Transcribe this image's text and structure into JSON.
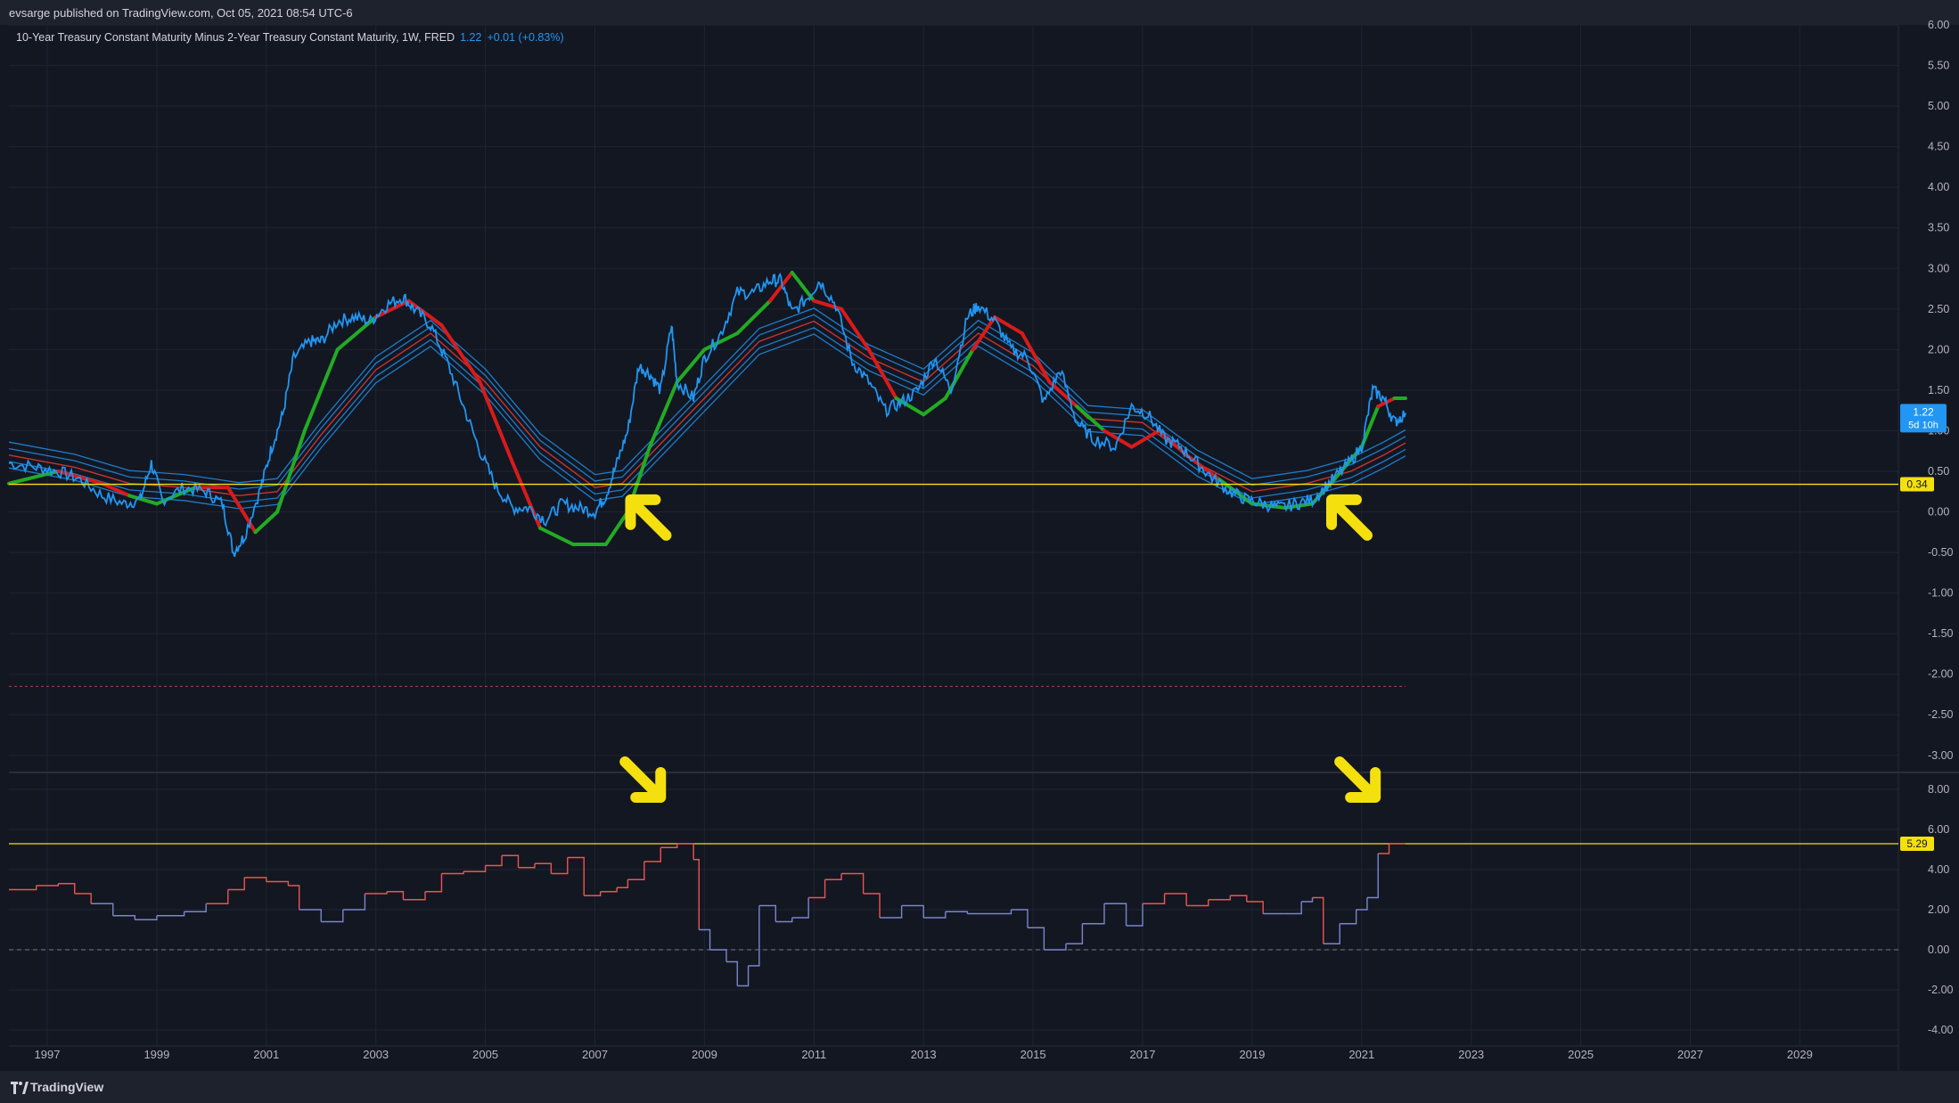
{
  "header": {
    "publisher": "evsarge published on TradingView.com, Oct 05, 2021 08:54 UTC-6"
  },
  "legend": {
    "symbol": "10-Year Treasury Constant Maturity Minus 2-Year Treasury Constant Maturity, 1W, FRED",
    "price": "1.22",
    "change": "+0.01 (+0.83%)"
  },
  "footer": {
    "brand": "TradingView",
    "logo_icon": "tradingview-logo-icon"
  },
  "colors": {
    "background": "#131722",
    "grid": "#1f2433",
    "price_line": "#2196f3",
    "ma_up": "#22ab23",
    "ma_down": "#d81b1b",
    "band": "#2196f3",
    "band_mid": "#e53935",
    "highlight_line": "#f5e00f",
    "oscillator_up": "#ef5350",
    "oscillator_down": "#7986cb"
  },
  "chart_data": [
    {
      "type": "line",
      "x_ticks": [
        "1997",
        "1999",
        "2001",
        "2003",
        "2005",
        "2007",
        "2009",
        "2011",
        "2013",
        "2015",
        "2017",
        "2019",
        "2021",
        "2023",
        "2025",
        "2027",
        "2029"
      ],
      "y_ticks": [
        "6.00",
        "5.50",
        "5.00",
        "4.50",
        "4.00",
        "3.50",
        "3.00",
        "2.50",
        "2.00",
        "1.50",
        "1.00",
        "0.50",
        "0.00",
        "-0.50",
        "-1.00",
        "-1.50",
        "-2.00",
        "-2.50",
        "-3.00"
      ],
      "ylim": [
        -3.2,
        6.0
      ],
      "xlim": [
        1996.3,
        2030.8
      ],
      "last_price_label": "1.22",
      "countdown_label": "5d 10h",
      "level_line_label": "0.34",
      "level_line_value": 0.34,
      "dashed_level": -2.15,
      "series": [
        {
          "key": "spread",
          "x": [
            1996.3,
            1996.8,
            1997.2,
            1997.6,
            1998.0,
            1998.4,
            1998.7,
            1998.9,
            1999.1,
            1999.5,
            1999.9,
            2000.2,
            2000.4,
            2000.6,
            2000.9,
            2001.1,
            2001.3,
            2001.5,
            2001.8,
            2002.0,
            2002.3,
            2002.6,
            2002.9,
            2003.2,
            2003.5,
            2003.7,
            2004.0,
            2004.3,
            2004.6,
            2004.9,
            2005.2,
            2005.5,
            2005.8,
            2006.1,
            2006.4,
            2006.7,
            2007.0,
            2007.2,
            2007.4,
            2007.6,
            2007.8,
            2008.0,
            2008.2,
            2008.4,
            2008.5,
            2008.8,
            2009.0,
            2009.3,
            2009.6,
            2009.9,
            2010.2,
            2010.4,
            2010.6,
            2010.9,
            2011.1,
            2011.4,
            2011.7,
            2012.0,
            2012.3,
            2012.6,
            2012.9,
            2013.2,
            2013.5,
            2013.8,
            2014.0,
            2014.3,
            2014.6,
            2014.9,
            2015.2,
            2015.5,
            2015.8,
            2016.1,
            2016.5,
            2016.8,
            2017.1,
            2017.4,
            2017.7,
            2018.0,
            2018.3,
            2018.6,
            2018.9,
            2019.2,
            2019.5,
            2019.8,
            2020.1,
            2020.4,
            2020.7,
            2021.0,
            2021.2,
            2021.4,
            2021.6,
            2021.8
          ],
          "y": [
            0.6,
            0.55,
            0.5,
            0.4,
            0.2,
            0.1,
            0.15,
            0.6,
            0.15,
            0.3,
            0.25,
            0.1,
            -0.5,
            -0.3,
            0.3,
            0.8,
            1.2,
            1.9,
            2.1,
            2.1,
            2.35,
            2.4,
            2.35,
            2.55,
            2.65,
            2.5,
            2.3,
            1.85,
            1.3,
            0.75,
            0.3,
            0.05,
            0.05,
            -0.1,
            0.1,
            0.05,
            0.0,
            0.2,
            0.6,
            1.0,
            1.8,
            1.7,
            1.5,
            2.3,
            1.6,
            1.4,
            1.9,
            2.2,
            2.7,
            2.7,
            2.85,
            2.85,
            2.45,
            2.65,
            2.85,
            2.55,
            1.85,
            1.6,
            1.25,
            1.35,
            1.5,
            1.9,
            1.5,
            2.4,
            2.55,
            2.35,
            2.0,
            1.9,
            1.35,
            1.75,
            1.1,
            0.9,
            0.8,
            1.3,
            1.2,
            0.9,
            0.8,
            0.6,
            0.4,
            0.25,
            0.15,
            0.1,
            0.05,
            0.1,
            0.15,
            0.35,
            0.55,
            0.8,
            1.5,
            1.4,
            1.1,
            1.22
          ]
        },
        {
          "key": "moving-average",
          "x": [
            1996.3,
            1997.2,
            1998.0,
            1998.5,
            1999.0,
            1999.7,
            2000.3,
            2000.8,
            2001.2,
            2001.7,
            2002.3,
            2003.0,
            2003.6,
            2004.2,
            2004.9,
            2005.5,
            2006.0,
            2006.6,
            2007.2,
            2007.6,
            2008.0,
            2008.5,
            2009.0,
            2009.6,
            2010.2,
            2010.6,
            2011.0,
            2011.5,
            2012.0,
            2012.5,
            2013.0,
            2013.4,
            2013.9,
            2014.3,
            2014.8,
            2015.3,
            2015.8,
            2016.3,
            2016.8,
            2017.3,
            2017.8,
            2018.4,
            2019.0,
            2019.6,
            2020.1,
            2020.5,
            2021.0,
            2021.3,
            2021.6,
            2021.8
          ],
          "y": [
            0.35,
            0.5,
            0.35,
            0.2,
            0.1,
            0.3,
            0.3,
            -0.25,
            0.0,
            1.0,
            2.0,
            2.4,
            2.6,
            2.3,
            1.6,
            0.6,
            -0.2,
            -0.4,
            -0.4,
            0.0,
            0.8,
            1.6,
            2.0,
            2.2,
            2.6,
            2.95,
            2.6,
            2.5,
            2.0,
            1.4,
            1.2,
            1.4,
            2.0,
            2.4,
            2.2,
            1.6,
            1.3,
            1.0,
            0.8,
            1.0,
            0.7,
            0.4,
            0.1,
            0.05,
            0.1,
            0.4,
            0.8,
            1.3,
            1.4,
            1.4
          ],
          "colors": [
            "up",
            "up",
            "down",
            "down",
            "up",
            "up",
            "down",
            "down",
            "up",
            "up",
            "up",
            "up",
            "down",
            "down",
            "down",
            "down",
            "down",
            "up",
            "up",
            "up",
            "up",
            "up",
            "up",
            "up",
            "up",
            "down",
            "up",
            "down",
            "down",
            "down",
            "up",
            "up",
            "up",
            "down",
            "down",
            "down",
            "down",
            "up",
            "down",
            "down",
            "down",
            "down",
            "up",
            "up",
            "up",
            "up",
            "up",
            "up",
            "down",
            "up"
          ]
        },
        {
          "key": "band-mid",
          "x": [
            1996.3,
            1997.5,
            1998.5,
            1999.5,
            2000.5,
            2001.2,
            2002.0,
            2003.0,
            2004.0,
            2005.0,
            2006.0,
            2007.0,
            2007.5,
            2008.0,
            2009.0,
            2010.0,
            2011.0,
            2012.0,
            2013.0,
            2014.0,
            2015.0,
            2016.0,
            2017.0,
            2018.0,
            2019.0,
            2020.0,
            2020.8,
            2021.4,
            2021.8
          ],
          "y": [
            0.7,
            0.55,
            0.35,
            0.3,
            0.2,
            0.25,
            0.95,
            1.75,
            2.2,
            1.6,
            0.8,
            0.3,
            0.35,
            0.7,
            1.4,
            2.1,
            2.35,
            1.9,
            1.6,
            2.2,
            1.8,
            1.15,
            1.1,
            0.6,
            0.25,
            0.35,
            0.5,
            0.7,
            0.85
          ]
        }
      ]
    },
    {
      "type": "line",
      "y_ticks": [
        "8.00",
        "6.00",
        "4.00",
        "2.00",
        "0.00",
        "-2.00",
        "-4.00"
      ],
      "ylim": [
        -4.8,
        8.8
      ],
      "level_line_label": "5.29",
      "level_line_value": 5.29,
      "zero_line": 0,
      "series": [
        {
          "key": "oscillator",
          "x": [
            1996.3,
            1996.8,
            1997.2,
            1997.5,
            1997.8,
            1998.2,
            1998.6,
            1999.0,
            1999.5,
            1999.9,
            2000.3,
            2000.6,
            2001.0,
            2001.4,
            2001.6,
            2002.0,
            2002.4,
            2002.8,
            2003.2,
            2003.5,
            2003.9,
            2004.2,
            2004.6,
            2005.0,
            2005.3,
            2005.6,
            2005.9,
            2006.2,
            2006.5,
            2006.8,
            2007.1,
            2007.4,
            2007.6,
            2007.9,
            2008.2,
            2008.5,
            2008.8,
            2008.9,
            2009.1,
            2009.4,
            2009.6,
            2009.8,
            2010.0,
            2010.3,
            2010.6,
            2010.9,
            2011.2,
            2011.5,
            2011.9,
            2012.2,
            2012.6,
            2013.0,
            2013.4,
            2013.8,
            2014.2,
            2014.6,
            2014.9,
            2015.2,
            2015.6,
            2015.9,
            2016.3,
            2016.7,
            2017.0,
            2017.4,
            2017.8,
            2018.2,
            2018.6,
            2018.9,
            2019.2,
            2019.6,
            2019.9,
            2020.1,
            2020.3,
            2020.6,
            2020.9,
            2021.1,
            2021.3,
            2021.5,
            2021.8
          ],
          "y": [
            3.0,
            3.2,
            3.3,
            2.8,
            2.3,
            1.7,
            1.5,
            1.7,
            1.9,
            2.3,
            3.0,
            3.6,
            3.4,
            3.2,
            2.0,
            1.4,
            2.0,
            2.8,
            2.9,
            2.5,
            2.9,
            3.8,
            3.9,
            4.2,
            4.7,
            4.1,
            4.3,
            3.8,
            4.6,
            2.7,
            2.9,
            3.1,
            3.5,
            4.4,
            5.1,
            5.29,
            4.5,
            1.0,
            0.0,
            -0.6,
            -1.8,
            -0.8,
            2.2,
            1.4,
            1.6,
            2.6,
            3.5,
            3.8,
            2.8,
            1.6,
            2.2,
            1.6,
            1.9,
            1.8,
            1.8,
            2.0,
            1.1,
            0.0,
            0.3,
            1.3,
            2.3,
            1.2,
            2.3,
            2.8,
            2.2,
            2.5,
            2.7,
            2.4,
            1.8,
            1.8,
            2.4,
            2.6,
            0.3,
            1.3,
            2.0,
            2.6,
            4.8,
            5.29,
            5.29
          ],
          "colors": [
            "up",
            "up",
            "up",
            "up",
            "down",
            "down",
            "down",
            "down",
            "down",
            "up",
            "up",
            "up",
            "up",
            "up",
            "down",
            "down",
            "down",
            "up",
            "up",
            "up",
            "up",
            "up",
            "up",
            "up",
            "up",
            "up",
            "up",
            "up",
            "up",
            "up",
            "up",
            "up",
            "up",
            "up",
            "up",
            "up",
            "up",
            "down",
            "down",
            "down",
            "down",
            "down",
            "down",
            "down",
            "down",
            "up",
            "up",
            "up",
            "up",
            "down",
            "down",
            "down",
            "down",
            "down",
            "down",
            "down",
            "down",
            "down",
            "down",
            "down",
            "down",
            "down",
            "up",
            "up",
            "up",
            "up",
            "up",
            "up",
            "down",
            "down",
            "down",
            "up",
            "down",
            "down",
            "down",
            "down",
            "up",
            "up",
            "up"
          ]
        }
      ]
    }
  ]
}
